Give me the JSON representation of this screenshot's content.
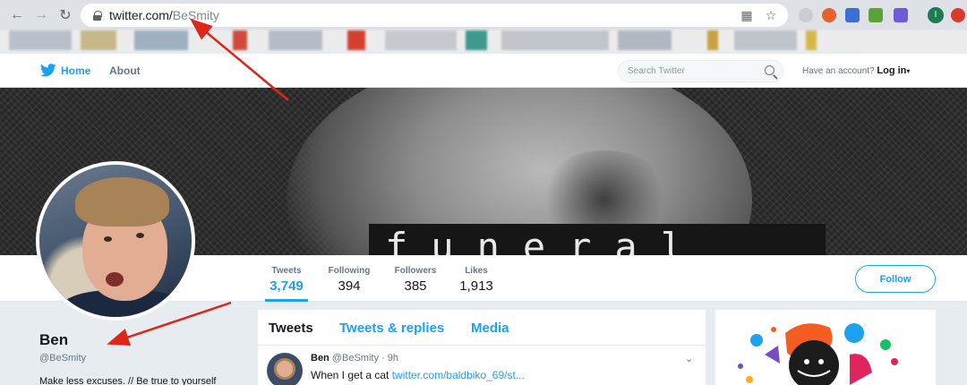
{
  "browser": {
    "url_host": "twitter.com/",
    "url_path": "BeSmity",
    "back_icon": "arrow-left-icon",
    "forward_icon": "arrow-right-icon",
    "reload_icon": "reload-icon",
    "profile_initial": "I"
  },
  "twitter_nav": {
    "home_label": "Home",
    "about_label": "About",
    "search_placeholder": "Search Twitter",
    "account_prompt": "Have an account?",
    "login_label": "Log in"
  },
  "banner": {
    "text": "funeral"
  },
  "profile_nav": {
    "stats": [
      {
        "label": "Tweets",
        "value": "3,749"
      },
      {
        "label": "Following",
        "value": "394"
      },
      {
        "label": "Followers",
        "value": "385"
      },
      {
        "label": "Likes",
        "value": "1,913"
      }
    ],
    "follow_label": "Follow"
  },
  "profile": {
    "name": "Ben",
    "handle": "@BeSmity",
    "bio": "Make less excuses. // Be true to yourself"
  },
  "timeline": {
    "tabs": [
      "Tweets",
      "Tweets & replies",
      "Media"
    ],
    "tweet": {
      "name": "Ben",
      "handle": "@BeSmity",
      "time": "· 9h",
      "text": "When I get a cat ",
      "link": "twitter.com/baldbiko_69/st..."
    }
  },
  "colors": {
    "accent": "#1da1f2",
    "annotation": "#e0261b"
  }
}
